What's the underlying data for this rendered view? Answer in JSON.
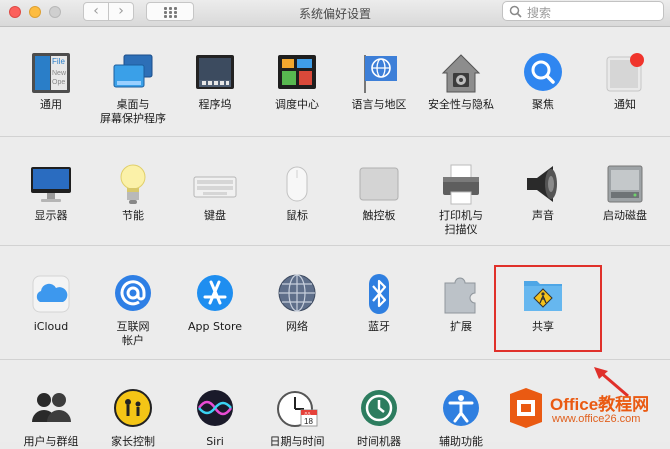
{
  "window": {
    "title": "系统偏好设置"
  },
  "toolbar": {
    "back_label": "‹",
    "forward_label": "›"
  },
  "search": {
    "placeholder": "搜索"
  },
  "rows": [
    [
      {
        "id": "general",
        "label": "通用"
      },
      {
        "id": "desktop",
        "label": "桌面与\n屏幕保护程序"
      },
      {
        "id": "dock",
        "label": "程序坞"
      },
      {
        "id": "mission",
        "label": "调度中心"
      },
      {
        "id": "language",
        "label": "语言与地区"
      },
      {
        "id": "security",
        "label": "安全性与隐私"
      },
      {
        "id": "spotlight",
        "label": "聚焦"
      },
      {
        "id": "notifications",
        "label": "通知"
      }
    ],
    [
      {
        "id": "displays",
        "label": "显示器"
      },
      {
        "id": "energy",
        "label": "节能"
      },
      {
        "id": "keyboard",
        "label": "键盘"
      },
      {
        "id": "mouse",
        "label": "鼠标"
      },
      {
        "id": "trackpad",
        "label": "触控板"
      },
      {
        "id": "printers",
        "label": "打印机与\n扫描仪"
      },
      {
        "id": "sound",
        "label": "声音"
      },
      {
        "id": "startup",
        "label": "启动磁盘"
      }
    ],
    [
      {
        "id": "icloud",
        "label": "iCloud"
      },
      {
        "id": "internet",
        "label": "互联网\n帐户"
      },
      {
        "id": "appstore",
        "label": "App Store"
      },
      {
        "id": "network",
        "label": "网络"
      },
      {
        "id": "bluetooth",
        "label": "蓝牙"
      },
      {
        "id": "extensions",
        "label": "扩展"
      },
      {
        "id": "sharing",
        "label": "共享"
      }
    ],
    [
      {
        "id": "users",
        "label": "用户与群组"
      },
      {
        "id": "parental",
        "label": "家长控制"
      },
      {
        "id": "siri",
        "label": "Siri"
      },
      {
        "id": "datetime",
        "label": "日期与时间"
      },
      {
        "id": "timemachine",
        "label": "时间机器"
      },
      {
        "id": "accessibility",
        "label": "辅助功能"
      }
    ]
  ],
  "icon_text": {
    "general_file": "File",
    "general_new": "New",
    "general_ope": "Ope",
    "calendar_day": "18",
    "calendar_month": "JUL"
  },
  "watermark": {
    "brand": "Office教程网",
    "url": "www.office26.com"
  },
  "colors": {
    "highlight": "#e0302a",
    "accent_blue": "#2f86f0",
    "brand_orange": "#ea5a12"
  }
}
